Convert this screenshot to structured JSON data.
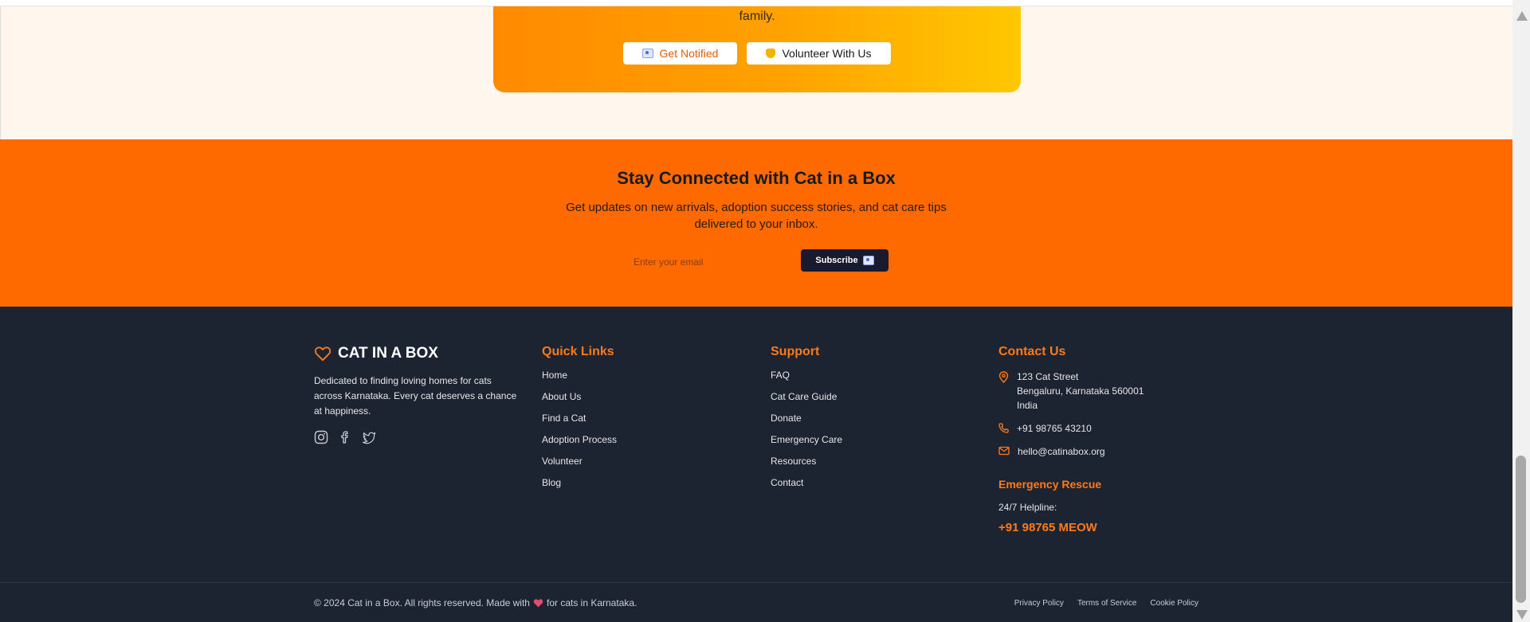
{
  "hero": {
    "text_tail": "family.",
    "notify_label": "Get Notified",
    "volunteer_label": "Volunteer With Us"
  },
  "newsletter": {
    "title": "Stay Connected with Cat in a Box",
    "subtitle": "Get updates on new arrivals, adoption success stories, and cat care tips delivered to your inbox.",
    "email_placeholder": "Enter your email",
    "subscribe_label": "Subscribe"
  },
  "footer": {
    "brand": "CAT IN A BOX",
    "description": "Dedicated to finding loving homes for cats across Karnataka. Every cat deserves a chance at happiness.",
    "quick_links_title": "Quick Links",
    "quick_links": [
      "Home",
      "About Us",
      "Find a Cat",
      "Adoption Process",
      "Volunteer",
      "Blog"
    ],
    "support_title": "Support",
    "support_links": [
      "FAQ",
      "Cat Care Guide",
      "Donate",
      "Emergency Care",
      "Resources",
      "Contact"
    ],
    "contact_title": "Contact Us",
    "address": {
      "line1": "123 Cat Street",
      "line2": "Bengaluru, Karnataka 560001",
      "line3": "India"
    },
    "phone": "+91 98765 43210",
    "email": "hello@catinabox.org",
    "emergency_title": "Emergency Rescue",
    "emergency_label": "24/7 Helpline:",
    "emergency_phone": "+91 98765 MEOW",
    "copyright_pre": "© 2024 Cat in a Box. All rights reserved. Made with",
    "copyright_post": "for cats in Karnataka.",
    "legal": [
      "Privacy Policy",
      "Terms of Service",
      "Cookie Policy"
    ]
  },
  "colors": {
    "accent": "#ff6a00",
    "footer_bg": "#1c2331",
    "footer_accent": "#ff7a1a",
    "heart": "#e84a6f"
  },
  "icons": {
    "brand": "heart-icon",
    "socials": [
      "instagram-icon",
      "facebook-icon",
      "twitter-icon"
    ],
    "contact": [
      "map-pin-icon",
      "phone-icon",
      "mail-icon"
    ]
  }
}
